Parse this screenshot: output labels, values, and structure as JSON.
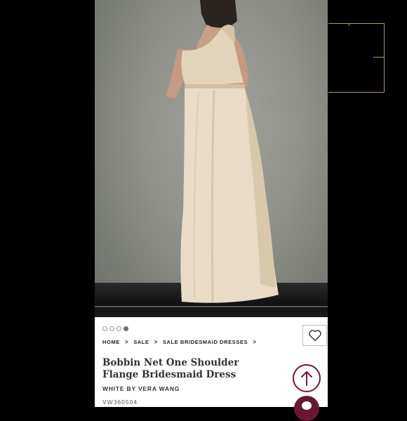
{
  "product": {
    "carousel": {
      "total": 4,
      "active_index": 3
    },
    "breadcrumb": [
      "HOME",
      "SALE",
      "SALE BRIDESMAID DRESSES"
    ],
    "breadcrumb_separator": ">",
    "title": "Bobbin Net One Shoulder Flange Bridesmaid Dress",
    "brand": "WHITE BY VERA WANG",
    "sku": "VW360504"
  },
  "buttons": {
    "favorite_icon": "heart-outline-icon",
    "scroll_top_icon": "arrow-up-icon",
    "chat_icon": "chat-icon"
  },
  "colors": {
    "accent": "#7a1535",
    "frame_gold": "#b29a5e",
    "dress": "#e8dcc6"
  }
}
